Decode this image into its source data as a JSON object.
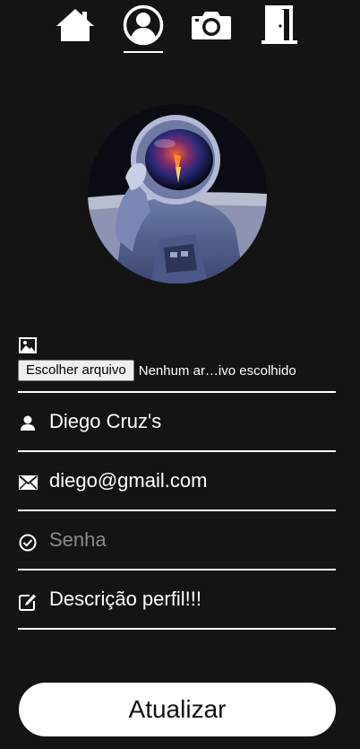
{
  "nav": {
    "items": [
      {
        "icon": "home-icon"
      },
      {
        "icon": "user-circle-icon",
        "active": true
      },
      {
        "icon": "camera-icon"
      },
      {
        "icon": "door-exit-icon"
      }
    ]
  },
  "profile": {
    "avatar": "astronaut-avatar"
  },
  "form": {
    "file_button_label": "Escolher arquivo",
    "file_status": "Nenhum ar…ivo escolhido",
    "name_value": "Diego Cruz's",
    "email_value": "diego@gmail.com",
    "password_placeholder": "Senha",
    "description_value": "Descrição perfil!!!",
    "submit_label": "Atualizar"
  },
  "colors": {
    "background": "#141414",
    "foreground": "#ffffff"
  }
}
